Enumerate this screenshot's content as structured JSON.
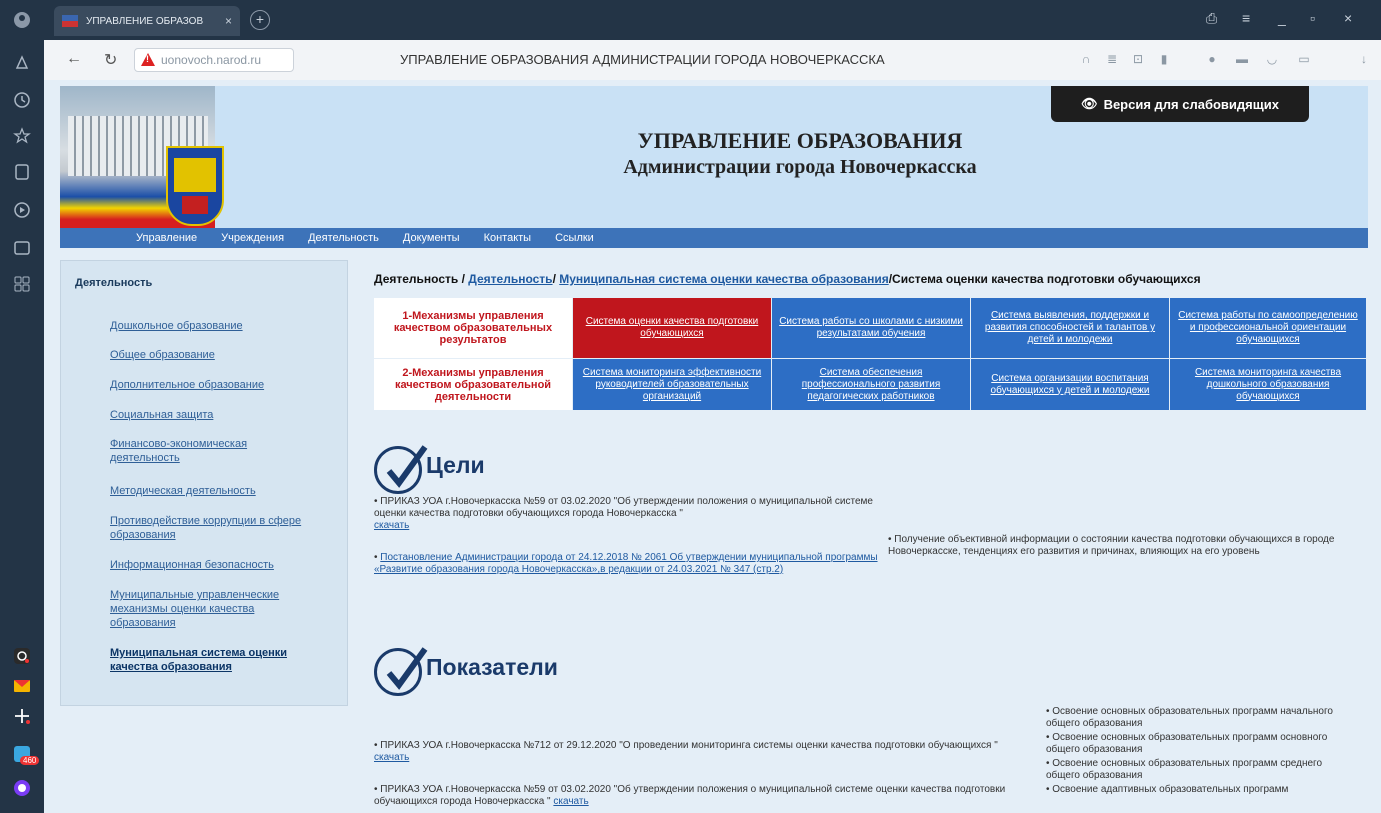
{
  "browser": {
    "tab_title": "УПРАВЛЕНИЕ ОБРАЗОВ",
    "tab_close": "×",
    "new_tab": "+",
    "url": "uonovoch.narod.ru",
    "page_title": "УПРАВЛЕНИЕ ОБРАЗОВАНИЯ АДМИНИСТРАЦИИ ГОРОДА НОВОЧЕРКАССКА"
  },
  "header": {
    "title": "УПРАВЛЕНИЕ ОБРАЗОВАНИЯ",
    "subtitle": "Администрации города Новочеркасска",
    "vision_button": "Версия для слабовидящих"
  },
  "nav": [
    "Управление",
    "Учреждения",
    "Деятельность",
    "Документы",
    "Контакты",
    "Ссылки"
  ],
  "leftpanel": {
    "heading": "Деятельность",
    "links": [
      "Дошкольное образование",
      "Общее образование",
      "Дополнительное образование",
      "Социальная защита",
      "Финансово-экономическая деятельность",
      "Методическая деятельность",
      "Противодействие коррупции в сфере образования",
      "Информационная безопасность",
      "Муниципальные управленческие механизмы оценки качества образования",
      "Муниципальная система оценки качества образования"
    ]
  },
  "breadcrumb": {
    "first": "Деятельность / ",
    "link1": "Деятельность",
    "sep1": "/ ",
    "link2": "Муниципальная система оценки качества образования",
    "last": "/Система оценки качества подготовки обучающихся"
  },
  "grid": {
    "row1_label": "1-Механизмы управления качеством образовательных результатов",
    "row1": [
      "Система оценки качества подготовки обучающихся",
      "Система работы со школами с низкими результатами обучения",
      "Система выявления, поддержки и развития способностей и талантов у детей и молодежи",
      "Система работы по самоопределению и профессиональной ориентации обучающихся"
    ],
    "row2_label": "2-Механизмы управления качеством образовательной деятельности",
    "row2": [
      "Система мониторинга эффективности руководителей образовательных организаций",
      "Система обеспечения профессионального развития педагогических работников",
      "Система организации воспитания обучающихся у детей и молодежи",
      "Система мониторинга качества дошкольного образования обучающихся"
    ]
  },
  "goals": {
    "title": "Цели",
    "item1": "•  ПРИКАЗ УОА г.Новочеркасска №59 от 03.02.2020 \"Об утверждении положения о муниципальной системе оценки качества подготовки обучающихся города Новочеркасска \"",
    "item1_link": "скачать",
    "item2_link": "Постановление Администрации города от 24.12.2018 № 2061 Об утверждении муниципальной программы «Развитие образования города Новочеркасска»,в редакции от 24.03.2021 № 347 (стр.2)",
    "right": "•  Получение объективной информации о состоянии качества подготовки обучающихся в городе Новочеркасске, тенденциях его развития и причинах, влияющих на его уровень"
  },
  "indicators": {
    "title": "Показатели",
    "item1": "•  ПРИКАЗ УОА г.Новочеркасска №712 от 29.12.2020 \"О проведении мониторинга системы оценки качества подготовки обучающихся \"",
    "item1_link": "скачать",
    "item2": "•  ПРИКАЗ УОА г.Новочеркасска №59 от 03.02.2020 \"Об утверждении положения о муниципальной системе оценки качества подготовки обучающихся города Новочеркасска \"",
    "item2_link": "скачать",
    "right": [
      "•  Освоение основных образовательных программ начального общего образования",
      "•  Освоение основных образовательных программ основного общего образования",
      "•  Освоение основных образовательных программ среднего общего образования",
      "•  Освоение адаптивных образовательных программ"
    ]
  },
  "badges": {
    "mail_count": "460"
  },
  "colors": {
    "accent_blue": "#2d6ec5",
    "accent_red": "#c0161d",
    "nav_blue": "#3d73b9"
  }
}
